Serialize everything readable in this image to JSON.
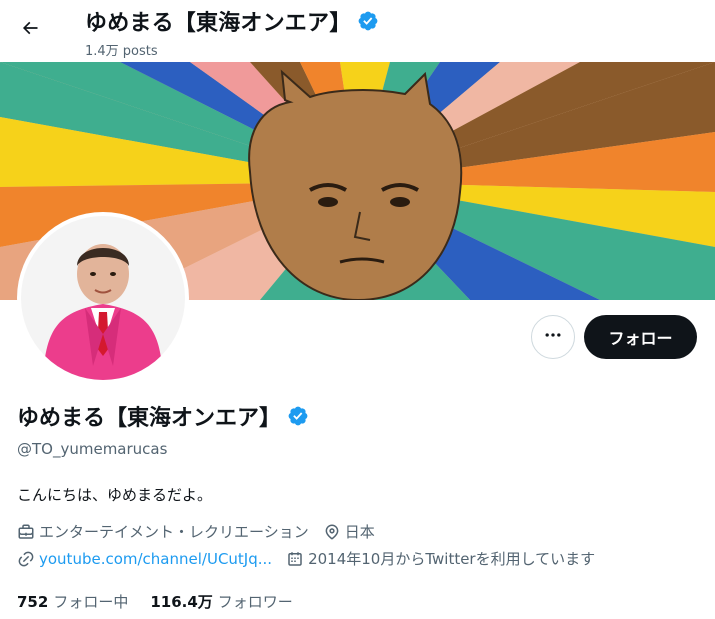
{
  "header": {
    "name": "ゆめまる【東海オンエア】",
    "posts": "1.4万 posts"
  },
  "profile": {
    "name": "ゆめまる【東海オンエア】",
    "handle": "@TO_yumemarucas",
    "bio": "こんにちは、ゆめまるだよ。",
    "category": "エンターテイメント・レクリエーション",
    "location": "日本",
    "website": "youtube.com/channel/UCutJq...",
    "joined": "2014年10月からTwitterを利用しています"
  },
  "actions": {
    "follow_label": "フォロー"
  },
  "stats": {
    "following_count": "752",
    "following_label": "フォロー中",
    "followers_count": "116.4万",
    "followers_label": "フォロワー"
  },
  "icons": [
    "back-arrow-icon",
    "verified-badge-icon",
    "more-icon",
    "briefcase-icon",
    "location-pin-icon",
    "link-icon",
    "calendar-icon"
  ],
  "colors": {
    "text": "#0f1419",
    "secondary_text": "#536471",
    "link": "#1d9bf0",
    "verified": "#1d9bf0",
    "follow_button_bg": "#0f1419",
    "follow_button_text": "#ffffff"
  }
}
